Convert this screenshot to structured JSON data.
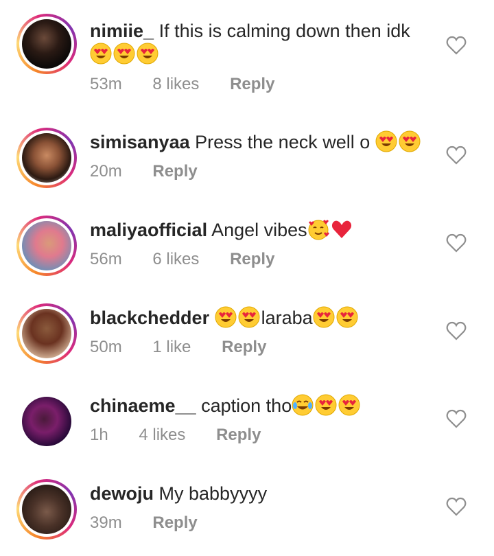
{
  "comments": [
    {
      "username": "nimiie_",
      "text": "If this is calming down then idk",
      "emoji_line": [
        "heart-eyes",
        "heart-eyes",
        "heart-eyes"
      ],
      "time": "53m",
      "likes": "8 likes",
      "reply": "Reply",
      "story_ring": true
    },
    {
      "username": "simisanyaa",
      "text": "Press the neck well o",
      "inline_emojis": [
        "heart-eyes",
        "heart-eyes"
      ],
      "time": "20m",
      "likes": "",
      "reply": "Reply",
      "story_ring": true
    },
    {
      "username": "maliyaofficial",
      "text": "Angel vibes",
      "inline_emojis": [
        "smiling-hearts",
        "red-heart"
      ],
      "time": "56m",
      "likes": "6 likes",
      "reply": "Reply",
      "story_ring": true
    },
    {
      "username": "blackchedder",
      "text_parts": [
        "",
        "laraba"
      ],
      "inline_emojis": [
        "heart-eyes",
        "heart-eyes",
        "heart-eyes",
        "heart-eyes"
      ],
      "time": "50m",
      "likes": "1 like",
      "reply": "Reply",
      "story_ring": true
    },
    {
      "username": "chinaeme__",
      "text": "caption tho",
      "inline_emojis": [
        "tears-of-joy",
        "heart-eyes",
        "heart-eyes"
      ],
      "time": "1h",
      "likes": "4 likes",
      "reply": "Reply",
      "story_ring": false
    },
    {
      "username": "dewoju",
      "text": "My babbyyyy",
      "time": "39m",
      "likes": "",
      "reply": "Reply",
      "story_ring": true
    }
  ],
  "colors": {
    "text": "#262626",
    "meta": "#8e8e8e",
    "ring_start": "#f58529",
    "ring_mid": "#dd2a7b",
    "ring_end": "#8134af"
  }
}
